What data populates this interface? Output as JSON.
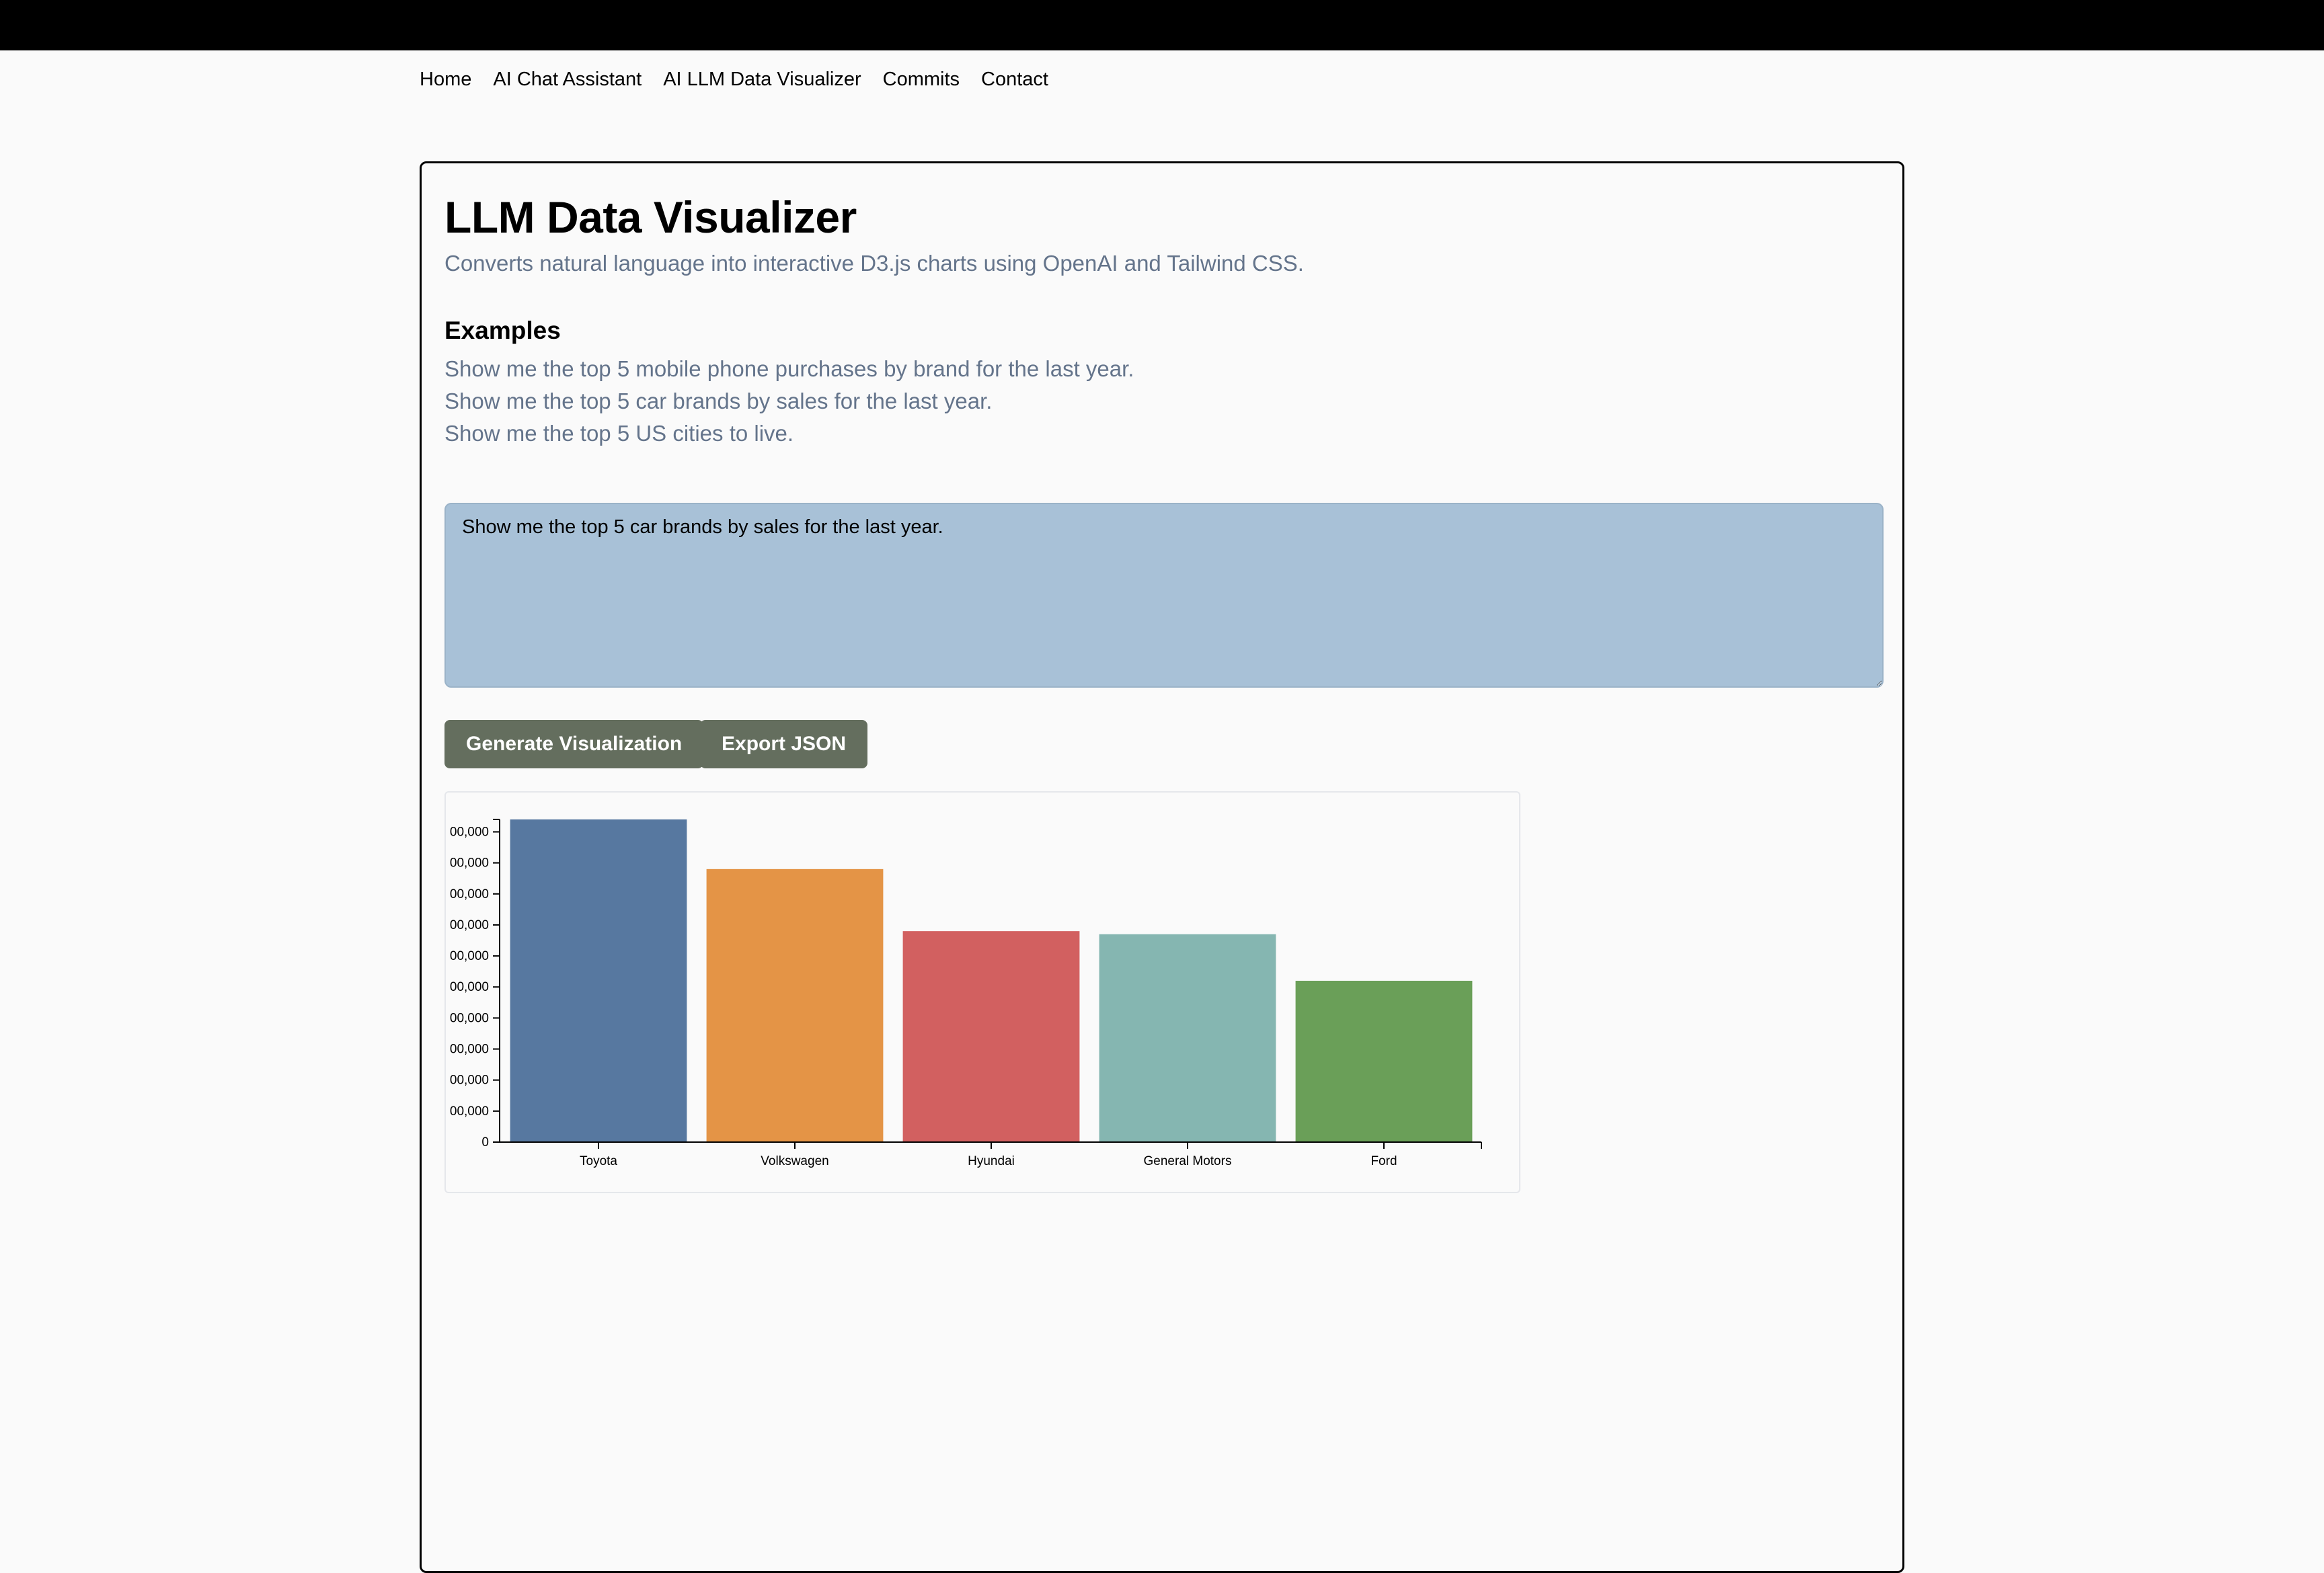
{
  "nav": {
    "items": [
      "Home",
      "AI Chat Assistant",
      "AI LLM Data Visualizer",
      "Commits",
      "Contact"
    ]
  },
  "page": {
    "title": "LLM Data Visualizer",
    "subtitle": "Converts natural language into interactive D3.js charts using OpenAI and Tailwind CSS."
  },
  "examples": {
    "heading": "Examples",
    "items": [
      "Show me the top 5 mobile phone purchases by brand for the last year.",
      "Show me the top 5 car brands by sales for the last year.",
      "Show me the top 5 US cities to live."
    ]
  },
  "prompt": {
    "value": "Show me the top 5 car brands by sales for the last year."
  },
  "buttons": {
    "generate": "Generate Visualization",
    "export": "Export JSON"
  },
  "colors": {
    "accent_button": "#646e5e",
    "textarea_bg": "#a8c1d7",
    "subtle_text": "#64748b"
  },
  "chart_data": {
    "type": "bar",
    "categories": [
      "Toyota",
      "Volkswagen",
      "Hyundai",
      "General Motors",
      "Ford"
    ],
    "values": [
      10400000,
      8800000,
      6800000,
      6700000,
      5200000
    ],
    "colors": [
      "#5778a0",
      "#e49446",
      "#d26060",
      "#85b6b1",
      "#6a9f58"
    ],
    "ylim": [
      0,
      10400000
    ],
    "yticks": [
      0,
      1000000,
      2000000,
      3000000,
      4000000,
      5000000,
      6000000,
      7000000,
      8000000,
      9000000,
      10000000
    ],
    "ytick_labels": [
      "0",
      "00,000",
      "00,000",
      "00,000",
      "00,000",
      "00,000",
      "00,000",
      "00,000",
      "00,000",
      "00,000",
      "00,000"
    ],
    "grid": false,
    "title": "",
    "xlabel": "",
    "ylabel": ""
  }
}
